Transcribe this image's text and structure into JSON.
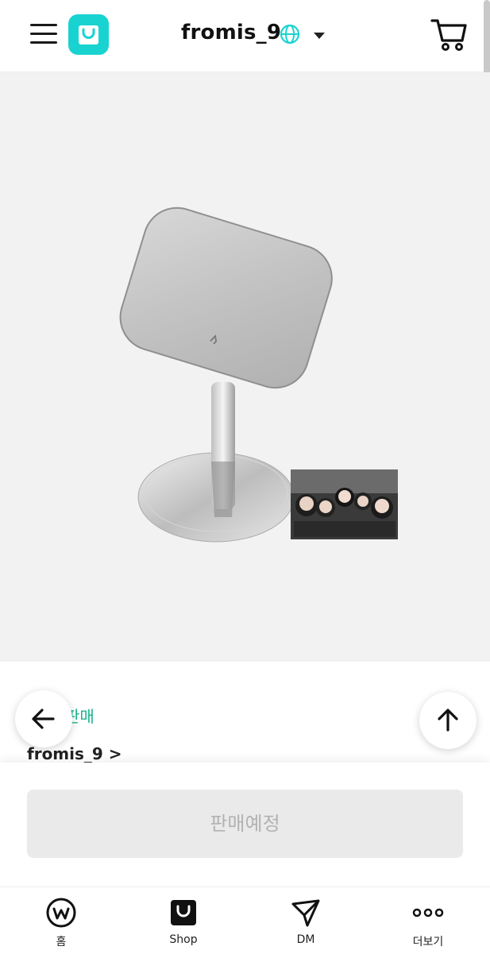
{
  "header": {
    "title": "fromis_9",
    "menu_icon": "hamburger-icon",
    "logo_icon": "shop-bag-icon",
    "globe_icon": "globe-icon",
    "dropdown_icon": "caret-down-icon",
    "cart_icon": "cart-icon",
    "brand_color": "#19d3d1"
  },
  "product": {
    "status_label": "판매",
    "artist_link": "fromis_9 >",
    "status_color": "#1ab48f"
  },
  "actions": {
    "back_icon": "arrow-left-icon",
    "top_icon": "arrow-up-icon",
    "cta_label": "판매예정"
  },
  "tabbar": {
    "items": [
      {
        "label": "홈",
        "icon": "weverse-home-icon"
      },
      {
        "label": "Shop",
        "icon": "shop-bag-icon"
      },
      {
        "label": "DM",
        "icon": "dm-icon"
      },
      {
        "label": "더보기",
        "icon": "more-icon"
      }
    ]
  }
}
